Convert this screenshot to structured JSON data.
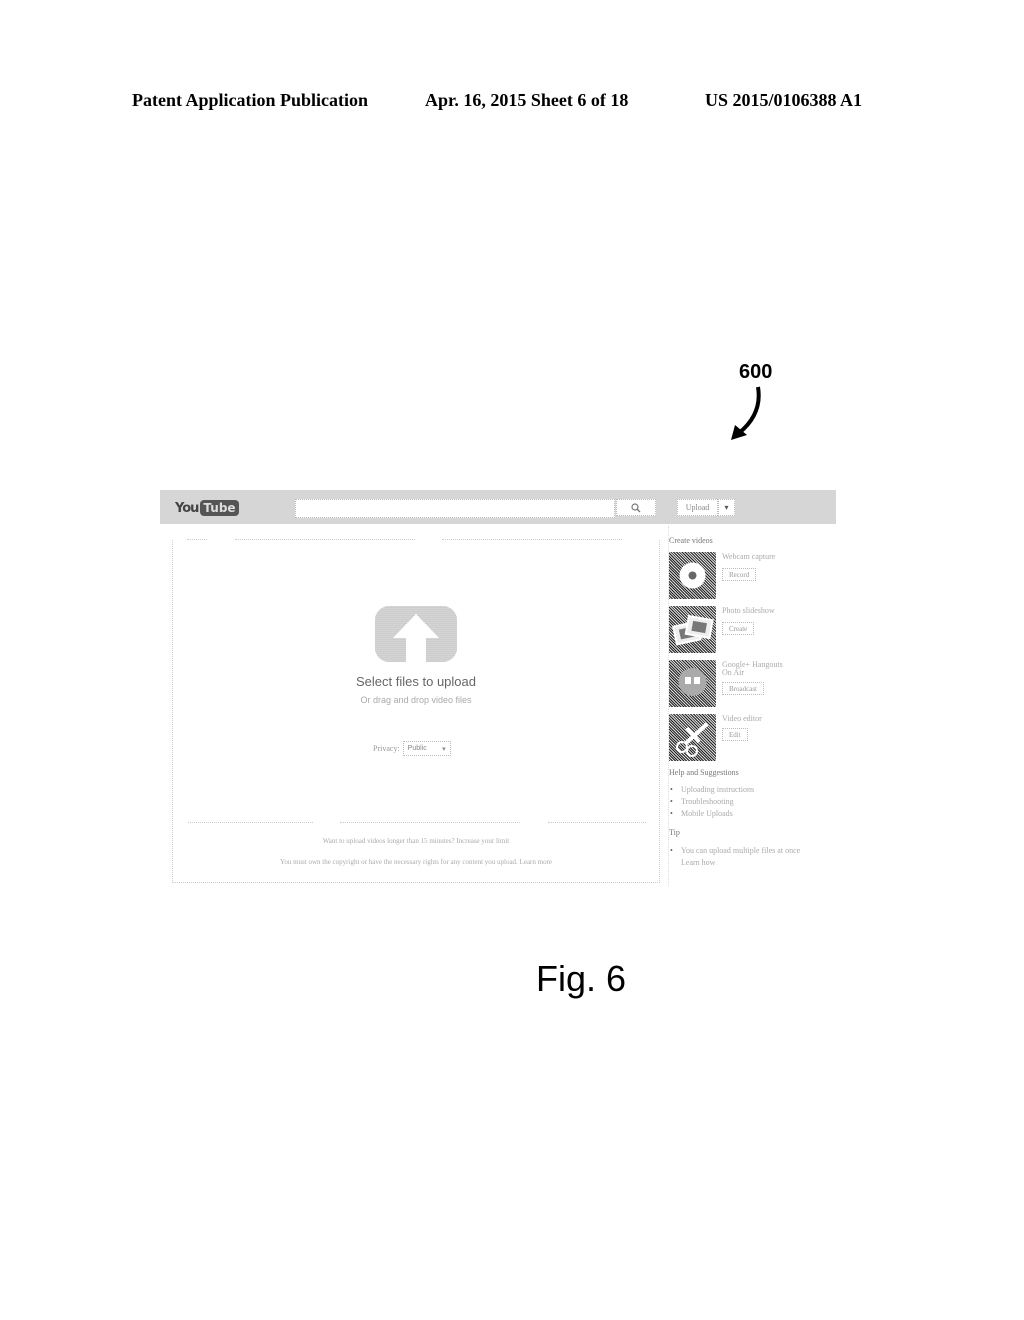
{
  "patent_header": {
    "left": "Patent Application Publication",
    "middle": "Apr. 16, 2015  Sheet 6 of 18",
    "right": "US 2015/0106388 A1"
  },
  "reference_numeral": "600",
  "figure_label": "Fig. 6",
  "topbar": {
    "logo_you": "You",
    "logo_tube": "Tube",
    "search_placeholder": "",
    "search_icon": "magnifier",
    "upload_label": "Upload",
    "upload_menu_icon": "▾"
  },
  "upload_panel": {
    "icon": "upload-arrow",
    "title": "Select files to upload",
    "subtitle": "Or drag and drop video files",
    "privacy_label": "Privacy:",
    "privacy_value": "Public",
    "privacy_caret": "▾",
    "footer_line1": "Want to upload videos longer than 15 minutes? Increase your limit",
    "footer_line2": "You must own the copyright or have the necessary rights for any content you upload. Learn more"
  },
  "sidebar": {
    "create_heading": "Create videos",
    "create_items": [
      {
        "title": "Webcam capture",
        "button": "Record",
        "icon": "webcam"
      },
      {
        "title": "Photo slideshow",
        "button": "Create",
        "icon": "photos"
      },
      {
        "title": "Google+ Hangouts On Air",
        "title_line1": "Google+ Hangouts",
        "title_line2": "On Air",
        "button": "Broadcast",
        "icon": "hangouts"
      },
      {
        "title": "Video editor",
        "button": "Edit",
        "icon": "scissors"
      }
    ],
    "help_heading": "Help and Suggestions",
    "help_items": [
      "Uploading instructions",
      "Troubleshooting",
      "Mobile Uploads"
    ],
    "tip_heading": "Tip",
    "tip_items": [
      "You can upload multiple files at once"
    ],
    "tip_link": "Learn how"
  }
}
